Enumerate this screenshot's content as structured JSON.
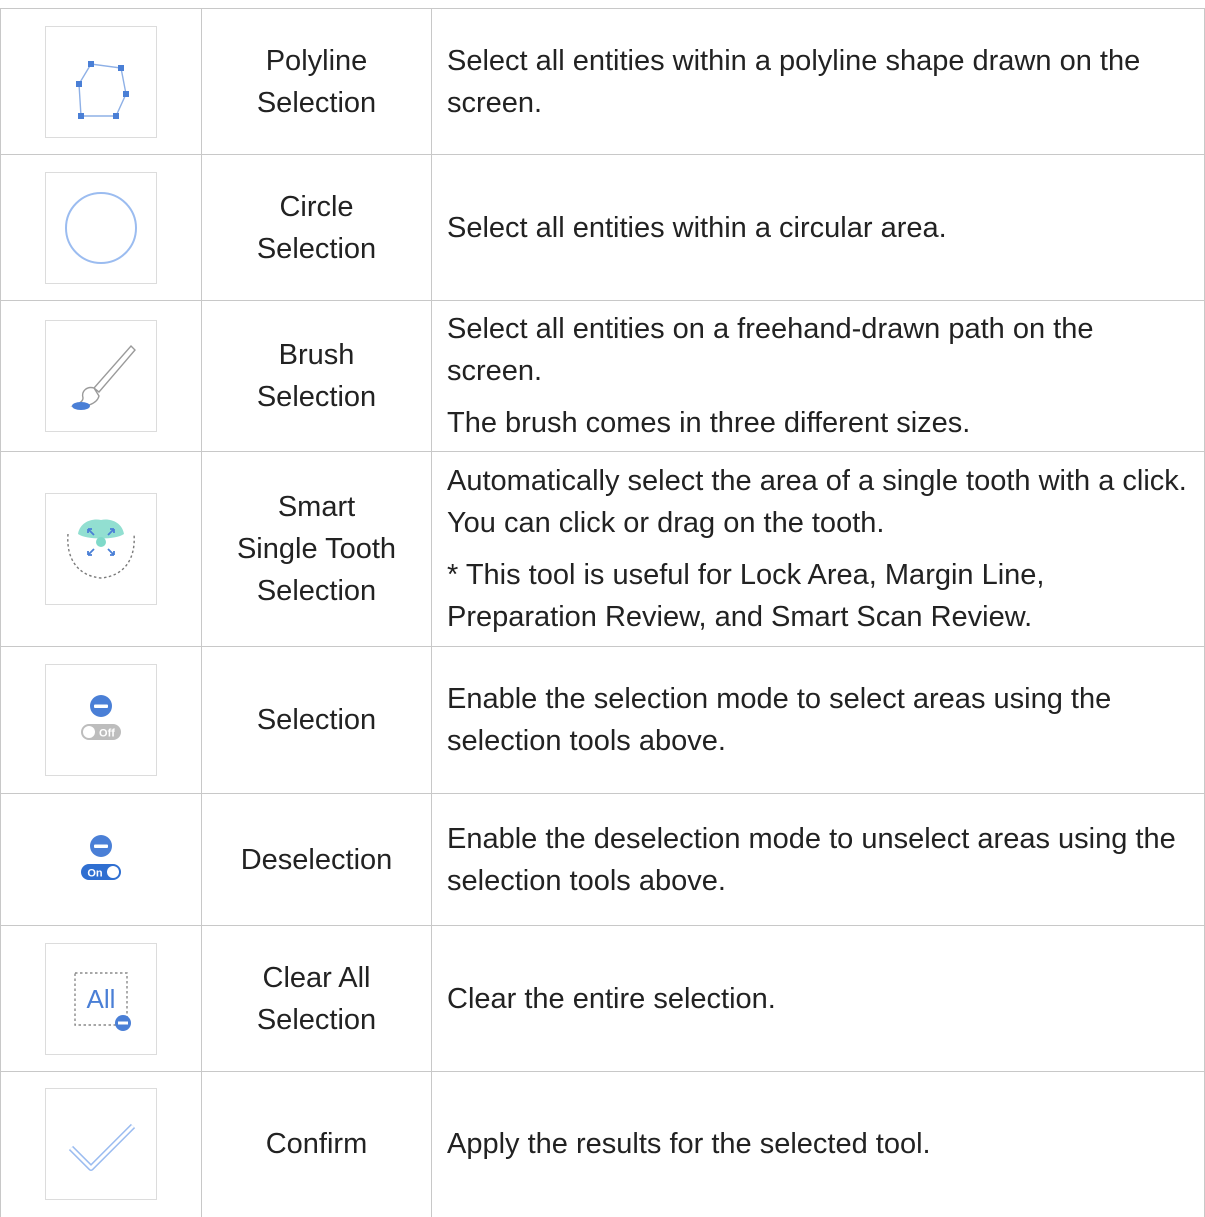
{
  "rows": [
    {
      "icon": "polyline-selection-icon",
      "name": [
        "Polyline",
        "Selection"
      ],
      "desc": [
        "Select all entities within a polyline shape drawn on the screen."
      ]
    },
    {
      "icon": "circle-selection-icon",
      "name": [
        "Circle",
        "Selection"
      ],
      "desc": [
        "Select all entities within a circular area."
      ]
    },
    {
      "icon": "brush-selection-icon",
      "name": [
        "Brush",
        "Selection"
      ],
      "desc": [
        "Select all entities on a freehand-drawn path on the screen.",
        "The brush comes in three different sizes."
      ]
    },
    {
      "icon": "smart-single-tooth-selection-icon",
      "name": [
        "Smart",
        "Single Tooth",
        "Selection"
      ],
      "desc": [
        "Automatically select the area of a single tooth with a click. You can click or drag on the tooth.",
        "* This tool is useful for Lock Area, Margin Line, Preparation Review, and Smart Scan Review."
      ]
    },
    {
      "icon": "selection-toggle-off-icon",
      "icon_toggle_text": "Off",
      "name": [
        "Selection"
      ],
      "desc": [
        "Enable the selection mode to select areas using the selection tools above."
      ]
    },
    {
      "icon": "deselection-toggle-on-icon",
      "icon_toggle_text": "On",
      "name": [
        "Deselection"
      ],
      "desc": [
        "Enable the deselection mode to unselect areas using the selection tools above."
      ]
    },
    {
      "icon": "clear-all-selection-icon",
      "icon_text": "All",
      "name": [
        "Clear All",
        "Selection"
      ],
      "desc": [
        "Clear the entire selection."
      ]
    },
    {
      "icon": "confirm-check-icon",
      "name": [
        "Confirm"
      ],
      "desc": [
        "Apply the results for the selected tool."
      ]
    }
  ],
  "colors": {
    "icon_blue": "#4a7fd6",
    "icon_light_blue": "#9bbcf0",
    "border": "#c8c8c8",
    "text": "#222222"
  }
}
